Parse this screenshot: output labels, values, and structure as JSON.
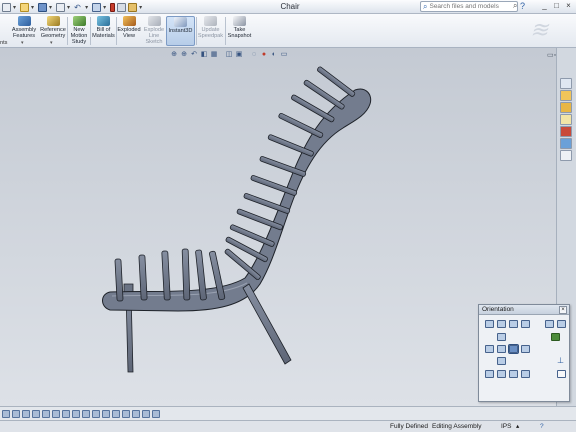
{
  "window": {
    "title": "Chair",
    "search_placeholder": "Search files and models",
    "help_label": "?",
    "controls": [
      "_",
      "□",
      "×"
    ]
  },
  "ribbon": {
    "left_label": "nts",
    "buttons": [
      {
        "id": "assembly-features",
        "label": "Assembly Features",
        "state": "normal"
      },
      {
        "id": "reference-geometry",
        "label": "Reference Geometry",
        "state": "normal"
      },
      {
        "id": "new-motion-study",
        "label": "New Motion Study",
        "state": "normal"
      },
      {
        "id": "bill-of-materials",
        "label": "Bill of Materials",
        "state": "normal"
      },
      {
        "id": "exploded-view",
        "label": "Exploded View",
        "state": "normal"
      },
      {
        "id": "explode-line-sketch",
        "label": "Explode Line Sketch",
        "state": "disabled"
      },
      {
        "id": "instant3d",
        "label": "Instant3D",
        "state": "active"
      },
      {
        "id": "update-speedpak",
        "label": "Update Speedpak",
        "state": "disabled"
      },
      {
        "id": "take-snapshot",
        "label": "Take Snapshot",
        "state": "normal"
      }
    ]
  },
  "orientation": {
    "title": "Orientation"
  },
  "status": {
    "fully_defined": "Fully Defined",
    "editing": "Editing Assembly",
    "units": "IPS",
    "help": "?"
  },
  "colors": {
    "part_fill": "#737c8e",
    "part_edge": "#1e2229",
    "viewport_top": "#c4cad3",
    "viewport_bottom": "#dde1e7",
    "active_button": "#b7cde8"
  },
  "icons": {
    "search": "search-icon",
    "help": "help-icon",
    "zoom": "zoom-icon",
    "close": "close-icon"
  }
}
